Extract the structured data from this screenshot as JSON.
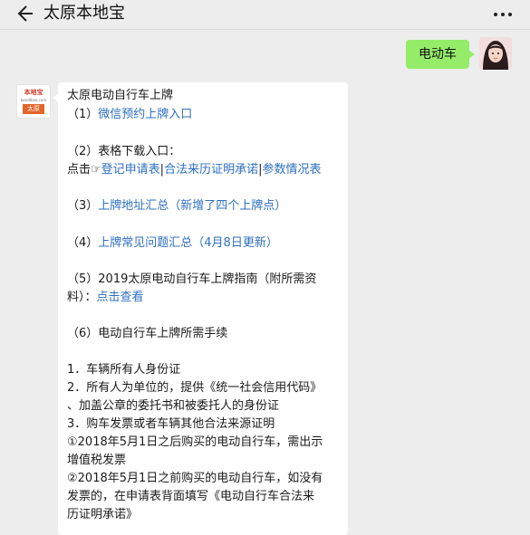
{
  "header": {
    "back_icon": "back-arrow-icon",
    "title": "太原本地宝",
    "more_icon": "more-dots-icon"
  },
  "user_message": {
    "text": "电动车",
    "bubble_color": "#95ec69"
  },
  "bot_avatar": {
    "logo_top": "本地宝",
    "logo_mid": "bendibao.com",
    "logo_city": "太原"
  },
  "reply": {
    "heading": "太原电动自行车上牌",
    "item1_prefix": "（1）",
    "item1_link": "微信预约上牌入口",
    "item2_text": "（2）表格下载入口：",
    "item2_click_prefix": "点击☞",
    "item2_link1": "登记申请表",
    "item2_sep1": "|",
    "item2_link2": "合法来历证明承诺",
    "item2_sep2": "|",
    "item2_link3": "参数情况表",
    "item3_prefix": "（3）",
    "item3_link": "上牌地址汇总（新增了四个上牌点）",
    "item4_prefix": "（4）",
    "item4_link": "上牌常见问题汇总（4月8日更新）",
    "item5_line1": "（5）2019太原电动自行车上牌指南（附所需资",
    "item5_line2_prefix": "料）：",
    "item5_link": "点击查看",
    "item6_text": "（6）电动自行车上牌所需手续",
    "req1": "1．车辆所有人身份证",
    "req2_line1": "2．所有人为单位的，提供《统一社会信用代码》",
    "req2_line2": "、加盖公章的委托书和被委托人的身份证",
    "req3": "3．购车发票或者车辆其他合法来源证明",
    "req3a_line1": "①2018年5月1日之后购买的电动自行车，需出示",
    "req3a_line2": "增值税发票",
    "req3b_line1": "②2018年5月1日之前购买的电动自行车，如没有",
    "req3b_line2": "发票的，在申请表背面填写《电动自行车合法来",
    "req3b_line3": "历证明承诺》",
    "link_color": "#2e6fc2"
  }
}
